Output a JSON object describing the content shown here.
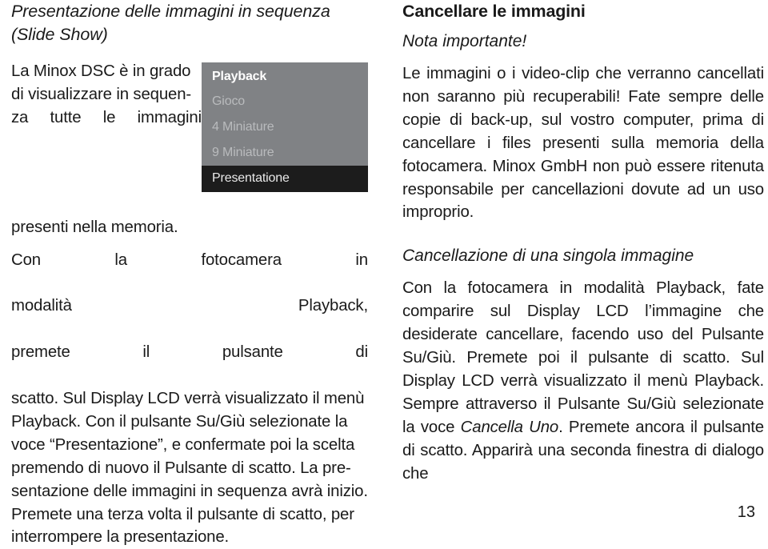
{
  "page": {
    "number": "13",
    "language": "it"
  },
  "left_column": {
    "heading_line1": "Presentazione delle immagini in sequenza",
    "heading_line2": "(Slide Show)",
    "paragraph1": "La Minox DSC è in grado di visualizzare in sequen-za tutte le immagini presenti nella memoria.",
    "paragraph1_lines": [
      "La Minox DSC è in grado di visualizzare in sequen-",
      "za tutte le immagini",
      "presenti nella memoria."
    ],
    "paragraph2_lines": [
      "Con la fotocamera in",
      "modalità Playback,",
      "premete il pulsante di",
      "scatto. Sul Display LCD verrà visualizzato il menù",
      "Playback. Con il pulsante Su/Giù selezionate la",
      "voce “Presentazione”, e confermate poi la scelta",
      "premendo di nuovo il Pulsante di scatto. La pre-",
      "sentazione delle immagini in sequenza avrà inizio.",
      "Premete una terza volta il pulsante di scatto, per",
      "interrompere la presentazione."
    ],
    "lcd_menu": {
      "items": [
        {
          "label": "Playback",
          "state": "title"
        },
        {
          "label": "Gioco",
          "state": "dim"
        },
        {
          "label": "4 Miniature",
          "state": "dim"
        },
        {
          "label": "9 Miniature",
          "state": "dim"
        },
        {
          "label": "Presentatione",
          "state": "selected"
        }
      ],
      "background_color": "#808285",
      "selected_background_color": "#1c1c1c",
      "title_color": "#ffffff",
      "dim_color": "#b9bbbd",
      "selected_color": "#e9e9e9"
    }
  },
  "right_column": {
    "heading": "Cancellare le immagini",
    "subheading_note": "Nota importante!",
    "paragraph1": "Le immagini o i video-clip che verranno cancellati non saranno più recuperabili! Fate sempre delle copie di back-up, sul vostro computer, prima di cancellare i files presenti sulla memoria della fotocamera. Minox GmbH non può essere ritenuta responsabile per cancellazioni dovute ad un uso improprio.",
    "subheading_section": "Cancellazione di una singola immagine",
    "paragraph2_part1": "Con la fotocamera in modalità Playback, fate comparire sul Display LCD l’immagine che desiderate cancellare, facendo uso del Pulsante Su/Giù. Premete poi il pulsante di scatto. Sul Display LCD verrà visualizzato il menù Playback. Sempre attraverso il Pulsante Su/Giù selezionate la voce ",
    "paragraph2_italic": "Cancella Uno",
    "paragraph2_part2": ". Premete ancora il pulsante di scatto. Apparirà una seconda finestra di dialogo che"
  }
}
